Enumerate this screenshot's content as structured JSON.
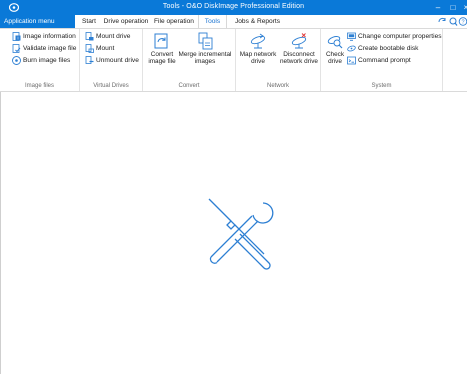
{
  "window": {
    "title": "Tools - O&O DiskImage Professional Edition",
    "controls": {
      "minimize": "–",
      "maximize": "□",
      "close": "×"
    }
  },
  "tabs": {
    "app_menu": "Application menu",
    "items": [
      "Start",
      "Drive operation",
      "File operation",
      "Tools",
      "Jobs & Reports"
    ],
    "active": "Tools"
  },
  "ribbon": {
    "image_files": {
      "label": "Image files",
      "buttons": [
        "Image information",
        "Validate image file",
        "Burn image files"
      ]
    },
    "virtual_drives": {
      "label": "Virtual Drives",
      "buttons": [
        "Mount drive",
        "Mount",
        "Unmount drive"
      ]
    },
    "convert": {
      "label": "Convert",
      "convert_line1": "Convert",
      "convert_line2": "image file",
      "merge_line1": "Merge incremental",
      "merge_line2": "images"
    },
    "network": {
      "label": "Network",
      "map_line1": "Map network",
      "map_line2": "drive",
      "disconnect_line1": "Disconnect",
      "disconnect_line2": "network drive"
    },
    "system": {
      "label": "System",
      "check_line1": "Check",
      "check_line2": "drive",
      "buttons": [
        "Change computer properties",
        "Create bootable disk",
        "Command prompt"
      ]
    }
  },
  "colors": {
    "accent": "#0a79d8",
    "icon_blue": "#2d7fd3"
  }
}
